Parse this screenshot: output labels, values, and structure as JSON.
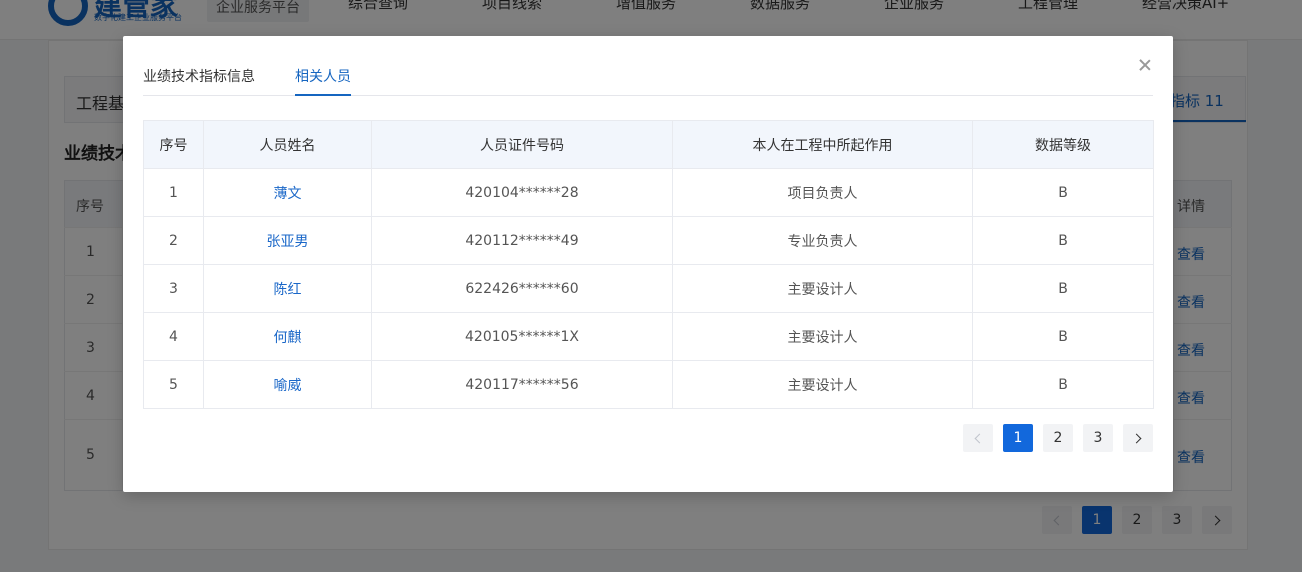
{
  "background": {
    "logo_text": "建管家",
    "logo_subtitle": "数字化建工企业服务平台",
    "platform_tag": "企业服务平台",
    "nav": [
      "综合查询",
      "项目线索",
      "增值服务",
      "数据服务",
      "企业服务",
      "工程管理",
      "经营决策AI+"
    ],
    "page_tab_first": "工程基",
    "page_tab_last": "指标 11",
    "section_title": "业绩技术",
    "table_header_index": "序号",
    "table_header_detail": "详情",
    "rows": [
      {
        "index": "1",
        "action": "查看"
      },
      {
        "index": "2",
        "action": "查看"
      },
      {
        "index": "3",
        "action": "查看"
      },
      {
        "index": "4",
        "action": "查看"
      },
      {
        "index": "5",
        "action": "查看"
      }
    ],
    "pagination": {
      "pages": [
        "1",
        "2",
        "3"
      ],
      "current": "1"
    }
  },
  "modal": {
    "tabs": [
      {
        "label": "业绩技术指标信息",
        "active": false
      },
      {
        "label": "相关人员",
        "active": true
      }
    ],
    "table": {
      "headers": [
        "序号",
        "人员姓名",
        "人员证件号码",
        "本人在工程中所起作用",
        "数据等级"
      ],
      "rows": [
        [
          "1",
          "薄文",
          "420104******28",
          "项目负责人",
          "B"
        ],
        [
          "2",
          "张亚男",
          "420112******49",
          "专业负责人",
          "B"
        ],
        [
          "3",
          "陈红",
          "622426******60",
          "主要设计人",
          "B"
        ],
        [
          "4",
          "何麒",
          "420105******1X",
          "主要设计人",
          "B"
        ],
        [
          "5",
          "喻威",
          "420117******56",
          "主要设计人",
          "B"
        ]
      ]
    },
    "pagination": {
      "pages": [
        "1",
        "2",
        "3"
      ],
      "current": "1"
    }
  },
  "colors": {
    "accent": "#1268dc",
    "link": "#1a67c8",
    "mask": "rgba(0,0,0,0.5)"
  }
}
